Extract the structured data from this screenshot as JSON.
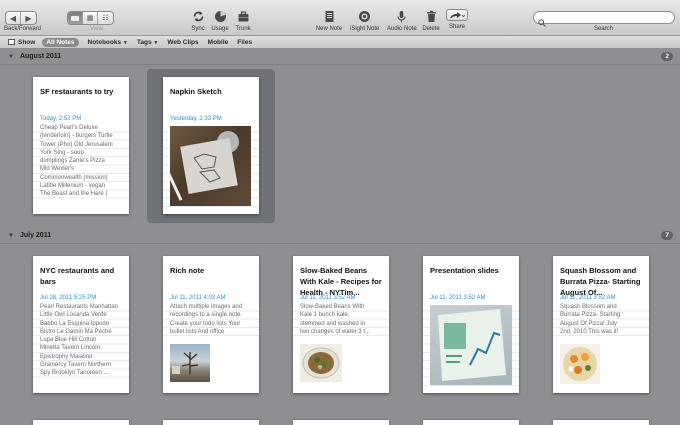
{
  "toolbar": {
    "back_forward_label": "Back/Forward",
    "view_label": "View",
    "sync_label": "Sync",
    "usage_label": "Usage",
    "trunk_label": "Trunk",
    "new_note_label": "New Note",
    "isight_note_label": "iSight Note",
    "audio_note_label": "Audio Note",
    "delete_label": "Delete",
    "share_label": "Share",
    "search_label": "Search",
    "search_value": ""
  },
  "filterbar": {
    "show_label": "Show",
    "all_notes_label": "All Notes",
    "notebooks_label": "Notebooks",
    "tags_label": "Tags",
    "web_clips_label": "Web Clips",
    "mobile_label": "Mobile",
    "files_label": "Files"
  },
  "sections": [
    {
      "title": "August 2011",
      "count": "2",
      "notes": [
        {
          "title": "SF restaurants to try",
          "date": "Today, 2:52 PM",
          "lines": [
            "Cheap Pearl's Deluxe",
            "(tenderloin) - burgers Turtle",
            "Tower (Pho) Old Jerusalem",
            "York Sing - soup",
            "dumplings Zante's Pizza",
            "Mid Wexler's",
            "Commonwealth (mission)",
            "Lafitte Millenium - vegan",
            "The Beast and the Hare ("
          ]
        },
        {
          "title": "Napkin Sketch",
          "date": "Yesterday, 2:33 PM",
          "lines": []
        }
      ]
    },
    {
      "title": "July 2011",
      "count": "7",
      "notes": [
        {
          "title": "NYC restaurants and bars",
          "date": "Jul 28, 2011 5:25 PM",
          "lines": [
            "Pearl Restaurants Manhattan",
            "Little Owl Locanda Verde",
            "Babbo La Esquina Ippudo",
            "Bistro Le Gamin Ma Peche",
            "Lupa Blue Hill Cotton",
            "Minetta Tavern Lincoln",
            "Epistrophy Maialino",
            "Gramercy Tavern Northern",
            "Spy Brooklyn Tanoreen ..."
          ]
        },
        {
          "title": "Rich note",
          "date": "Jul 11, 2011 4:03 AM",
          "lines": [
            "Attach multiple images and",
            "recordings to a single note.",
            "Create your todo lists Your",
            "bullet lists And office"
          ]
        },
        {
          "title": "Slow-Baked Beans With Kale - Recipes for Health - NYTim...",
          "date": "Jul 11, 2011 3:52 AM",
          "lines": [
            "Slow-Baked Beans With",
            "Kale 1 bunch kale,",
            "stemmed and washed in",
            "two changes of water 3 t..."
          ]
        },
        {
          "title": "Presentation slides",
          "date": "Jul 11, 2011 3:52 AM",
          "lines": []
        },
        {
          "title": "Squash Blossom and Burrata Pizza- Starting August Of...",
          "date": "Jul 11, 2011 3:52 AM",
          "lines": [
            "Squash Blossom and",
            "Burrata Pizza- Starting",
            "August Of Pizza! July",
            "2nd, 2010 This was it!"
          ]
        }
      ]
    }
  ]
}
